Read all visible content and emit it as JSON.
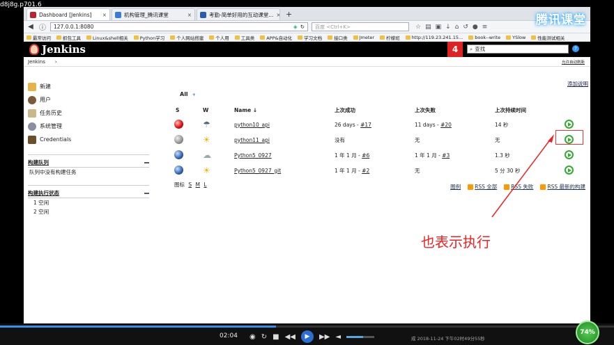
{
  "watermark": "d8j8g.p701.6",
  "browser": {
    "tabs": [
      {
        "label": "Dashboard [Jenkins]",
        "close": "×",
        "active": true
      },
      {
        "label": "机构管理_腾讯课堂",
        "close": "×",
        "active": false
      },
      {
        "label": "考勤-简单好用的互动课堂...",
        "close": "×",
        "active": false
      }
    ],
    "new_tab": "+",
    "url": "127.0.0.1:8080",
    "search_placeholder": "百度 <Ctrl+K>",
    "bookmarks": [
      "最常访问",
      "抓包工具",
      "Linux&shell相关",
      "Python学习",
      "个人网站搭建",
      "个人用",
      "工具类",
      "APP&自动化",
      "学习文档",
      "接口类",
      "Jmeter",
      "柠檬班",
      "http://119.23.241.15...",
      "book--write",
      "YSlow",
      "性能测试相关"
    ]
  },
  "overlay_logo": "腾讯课堂",
  "jenkins": {
    "logo_text": "Jenkins",
    "badge": "4",
    "search_placeholder": "查找",
    "help": "?",
    "breadcrumb": "Jenkins",
    "breadcrumb_sep": "›",
    "auto_refresh": "允许自动刷新",
    "add_description": "添加说明",
    "sidebar": [
      {
        "label": "新建",
        "icon": "new-item-icon"
      },
      {
        "label": "用户",
        "icon": "people-icon"
      },
      {
        "label": "任务历史",
        "icon": "history-icon"
      },
      {
        "label": "系统管理",
        "icon": "gear-icon"
      },
      {
        "label": "Credentials",
        "icon": "credentials-icon"
      }
    ],
    "queue": {
      "title": "构建队列",
      "empty": "队列中没有构建任务"
    },
    "executors": {
      "title": "构建执行状态",
      "items": [
        "1  空闲",
        "2  空闲"
      ]
    },
    "view_tab": "All",
    "view_plus": "+",
    "columns": {
      "s": "S",
      "w": "W",
      "name": "Name  ↓",
      "last_success": "上次成功",
      "last_failure": "上次失败",
      "last_duration": "上次持续时间"
    },
    "jobs": [
      {
        "name": "python10_api",
        "status": "red",
        "weather": "storm",
        "last_success": "26 days - ",
        "success_link": "#17",
        "last_failure": "11 days - ",
        "failure_link": "#20",
        "duration": "14 秒"
      },
      {
        "name": "python11_api",
        "status": "grey",
        "weather": "sun",
        "last_success": "没有",
        "success_link": "",
        "last_failure": "无",
        "failure_link": "",
        "duration": "无"
      },
      {
        "name": "Python5_0927",
        "status": "blue",
        "weather": "cloud",
        "last_success": "1 年 1 月 - ",
        "success_link": "#6",
        "last_failure": "1 年 1 月 - ",
        "failure_link": "#3",
        "duration": "1.3 秒"
      },
      {
        "name": "Python5_0927_git",
        "status": "blue",
        "weather": "sun",
        "last_success": "1 年 1 月 - ",
        "success_link": "#2",
        "last_failure": "无",
        "failure_link": "",
        "duration": "5 分 30 秒"
      }
    ],
    "icon_legend": {
      "label": "图标",
      "sizes": [
        "S",
        "M",
        "L"
      ]
    },
    "rss": {
      "legend": "图例",
      "all": "RSS 全部",
      "failed": "RSS 失败",
      "latest": "RSS 最新的构建"
    }
  },
  "annotation": "也表示执行",
  "player": {
    "time": "02:04",
    "percent": "74%",
    "status_text": "成  2018-11-24 下午02时49分55秒"
  },
  "colors": {
    "annotation": "#e22222",
    "accent": "#2d6fd0"
  }
}
